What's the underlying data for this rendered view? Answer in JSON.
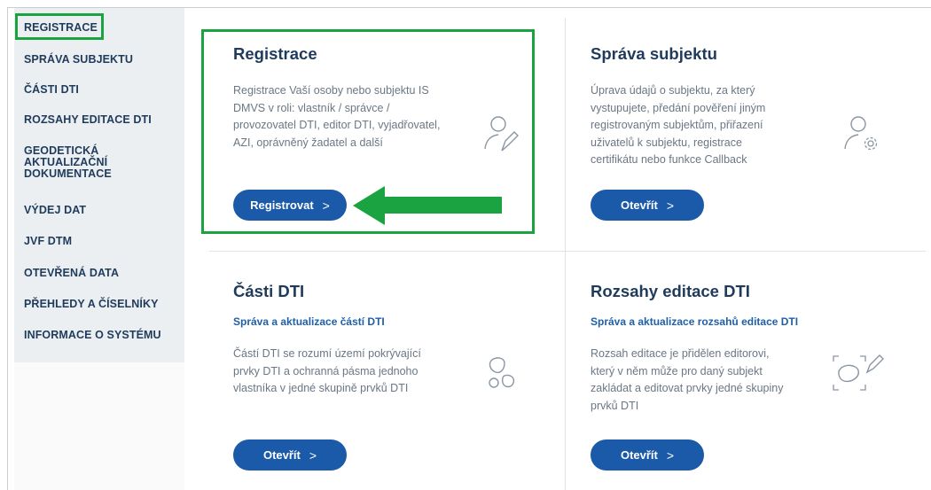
{
  "sidebar": {
    "items": [
      {
        "label": "REGISTRACE"
      },
      {
        "label": "SPRÁVA SUBJEKTU"
      },
      {
        "label": "ČÁSTI DTI"
      },
      {
        "label": "ROZSAHY EDITACE DTI"
      },
      {
        "label": "GEODETICKÁ AKTUALIZAČNÍ DOKUMENTACE"
      },
      {
        "label": "VÝDEJ DAT"
      },
      {
        "label": "JVF DTM"
      },
      {
        "label": "OTEVŘENÁ DATA"
      },
      {
        "label": "PŘEHLEDY A ČÍSELNÍKY"
      },
      {
        "label": "INFORMACE O SYSTÉMU"
      }
    ]
  },
  "cards": [
    {
      "title": "Registrace",
      "subtitle": "",
      "description": "Registrace Vaší osoby nebo subjektu IS DMVS v roli: vlastník / správce / provozovatel DTI, editor DTI, vyjadřovatel, AZI, oprávněný žadatel a další",
      "button": "Registrovat",
      "icon": "user-edit-icon"
    },
    {
      "title": "Správa subjektu",
      "subtitle": "",
      "description": "Úprava údajů o subjektu, za který vystupujete, předání pověření jiným registrovaným subjektům, přiřazení uživatelů k subjektu, registrace certifikátu nebo funkce Callback",
      "button": "Otevřít",
      "icon": "user-settings-icon"
    },
    {
      "title": "Části DTI",
      "subtitle": "Správa a aktualizace částí DTI",
      "description": "Částí DTI se rozumí území pokrývající prvky DTI a ochranná pásma jednoho vlastníka v jedné skupině prvků DTI",
      "button": "Otevřít",
      "icon": "shapes-icon"
    },
    {
      "title": "Rozsahy editace DTI",
      "subtitle": "Správa a aktualizace rozsahů editace DTI",
      "description": "Rozsah editace je přidělen editorovi, který v něm může pro daný subjekt zakládat a editovat prvky jedné skupiny prvků DTI",
      "button": "Otevřít",
      "icon": "area-edit-icon"
    }
  ],
  "colors": {
    "accent": "#1a5aa8",
    "highlight": "#1aa340",
    "title": "#1f3b5c"
  }
}
